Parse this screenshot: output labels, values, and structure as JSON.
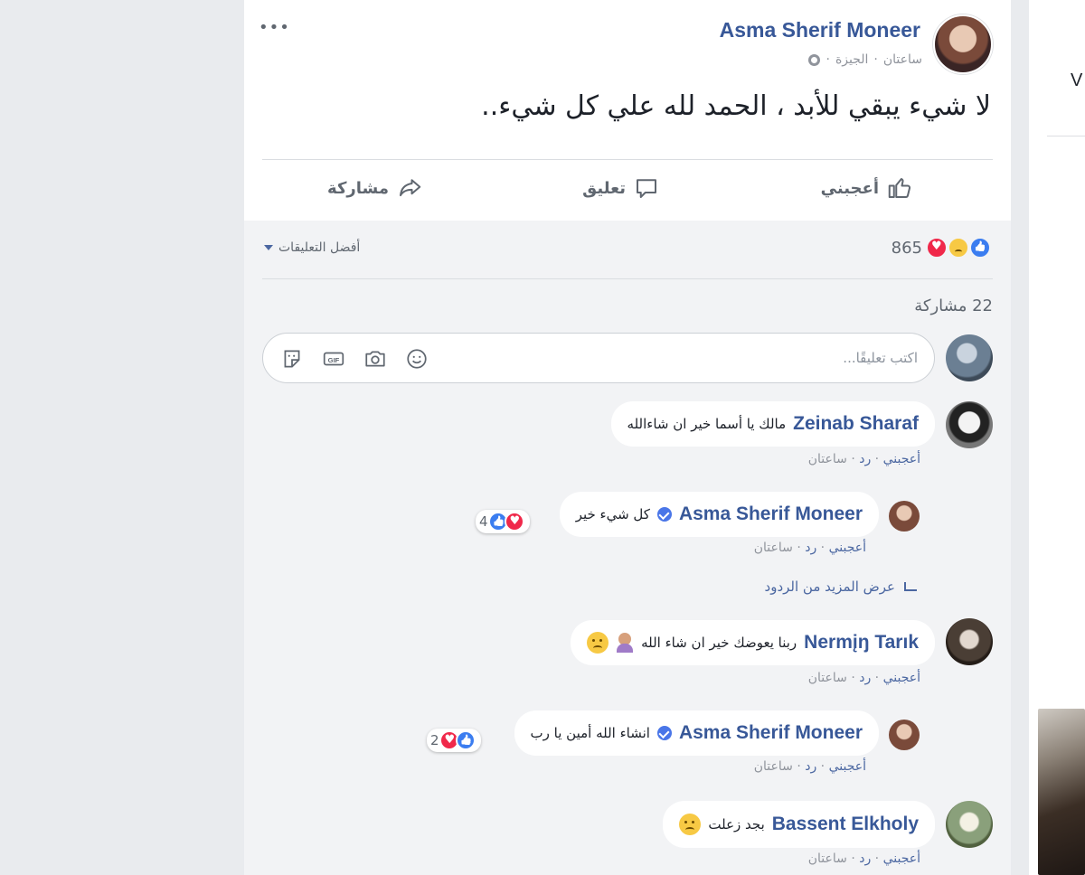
{
  "post": {
    "more_label": "•••",
    "author": "Asma Sherif Moneer",
    "time": "ساعتان",
    "sep": "·",
    "location": "الجيزة",
    "text": "لا شيء يبقي للأبد ، الحمد لله علي كل شيء..",
    "actions": {
      "like": "أعجبني",
      "comment": "تعليق",
      "share": "مشاركة"
    },
    "reaction_count": "865",
    "sort_label": "أفضل التعليقات",
    "shares": "22 مشاركة",
    "comment_placeholder": "اكتب تعليقًا..."
  },
  "comments": [
    {
      "author": "Zeinab Sharaf",
      "text": "مالك يا أسما خير ان شاءالله",
      "like": "أعجبني",
      "reply": "رد",
      "time": "ساعتان"
    },
    {
      "author": "Asma Sherif Moneer",
      "text": "كل شيء خير",
      "reactions": "4",
      "like": "أعجبني",
      "reply": "رد",
      "time": "ساعتان"
    },
    {
      "author": "Nermįŋ Tarık",
      "text": "ربنا يعوضك خير ان شاء الله",
      "like": "أعجبني",
      "reply": "رد",
      "time": "ساعتان"
    },
    {
      "author": "Asma Sherif Moneer",
      "text": "انشاء الله أمين يا رب",
      "reactions": "2",
      "like": "أعجبني",
      "reply": "رد",
      "time": "ساعتان"
    },
    {
      "author": "Bassent Elkholy",
      "text": "بجد زعلت",
      "like": "أعجبني",
      "reply": "رد",
      "time": "ساعتان"
    }
  ],
  "more_replies": "عرض المزيد من الردود",
  "sidebar": {
    "partial_letter": "V"
  },
  "colors": {
    "link": "#385898",
    "accent": "#4b67a1",
    "bg": "#f2f3f5"
  }
}
